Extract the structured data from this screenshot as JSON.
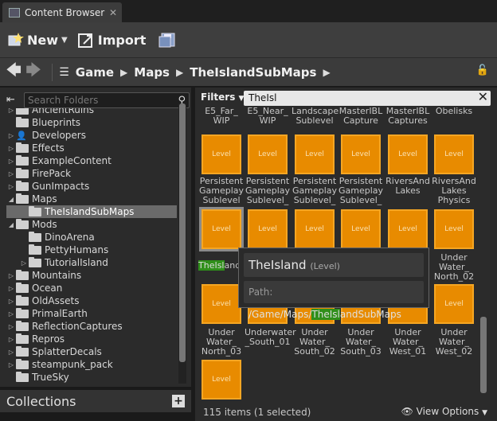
{
  "tab": {
    "title": "Content Browser",
    "close": "✕"
  },
  "toolbar": {
    "new_label": "New",
    "import_label": "Import"
  },
  "path": {
    "segments": [
      "Game",
      "Maps",
      "TheIslandSubMaps"
    ]
  },
  "left": {
    "search_placeholder": "Search Folders",
    "folders": [
      {
        "name": "AncientRuins",
        "tri": "▷"
      },
      {
        "name": "Blueprints",
        "tri": ""
      },
      {
        "name": "Developers",
        "tri": "▷"
      },
      {
        "name": "Effects",
        "tri": "▷"
      },
      {
        "name": "ExampleContent",
        "tri": "▷"
      },
      {
        "name": "FirePack",
        "tri": "▷"
      },
      {
        "name": "GunImpacts",
        "tri": "▷"
      },
      {
        "name": "Maps",
        "tri": "◢"
      },
      {
        "name": "TheIslandSubMaps",
        "tri": ""
      },
      {
        "name": "Mods",
        "tri": "◢"
      },
      {
        "name": "DinoArena",
        "tri": ""
      },
      {
        "name": "PettyHumans",
        "tri": ""
      },
      {
        "name": "TutorialIsland",
        "tri": "▷"
      },
      {
        "name": "Mountains",
        "tri": "▷"
      },
      {
        "name": "Ocean",
        "tri": "▷"
      },
      {
        "name": "OldAssets",
        "tri": "▷"
      },
      {
        "name": "PrimalEarth",
        "tri": "▷"
      },
      {
        "name": "ReflectionCaptures",
        "tri": "▷"
      },
      {
        "name": "Repros",
        "tri": "▷"
      },
      {
        "name": "SplatterDecals",
        "tri": "▷"
      },
      {
        "name": "steampunk_pack",
        "tri": "▷"
      },
      {
        "name": "TrueSky",
        "tri": ""
      }
    ],
    "collections_label": "Collections"
  },
  "filter": {
    "label": "Filters",
    "value": "TheIsl"
  },
  "assets": {
    "tile_text": "Level",
    "row0_labels": [
      "E5_Far_\nWIP",
      "E5_Near_\nWIP",
      "Landscape\nSublevel",
      "MasterIBL\nCapture",
      "MasterIBL\nCaptures",
      "Obelisks"
    ],
    "row1_labels": [
      "Persistent\nGameplay\nSublevel",
      "Persistent\nGameplay\nSublevel_",
      "Persistent\nGameplay\nSublevel_",
      "Persistent\nGameplay\nSublevel_",
      "RiversAnd\nLakes",
      "RiversAnd\nLakes\nPhysics"
    ],
    "row2_labels": [
      "TheIsland",
      "",
      "",
      "",
      "",
      "Under\nWater_\nNorth_02"
    ],
    "row3_labels": [
      "Under\nWater_\nNorth_03",
      "Underwater\n_South_01",
      "Under\nWater_\nSouth_02",
      "Under\nWater_\nSouth_03",
      "Under\nWater_\nWest_01",
      "Under\nWater_\nWest_02"
    ]
  },
  "tooltip": {
    "name": "TheIsland",
    "type": "(Level)",
    "path_label": "Path:",
    "path_prefix": "/Game/Maps/",
    "path_hl": "TheIsl",
    "path_suffix": "andSubMaps"
  },
  "status": {
    "count": "115 items (1 selected)",
    "view_options": "View Options"
  }
}
